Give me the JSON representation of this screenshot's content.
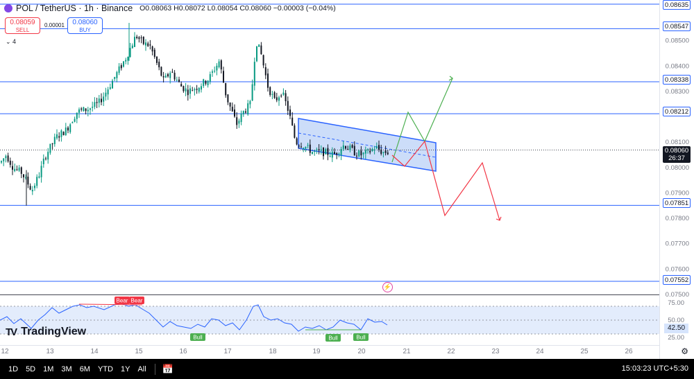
{
  "header": {
    "symbol": "POL / TetherUS · 1h · Binance",
    "ohlc": "O0.08063 H0.08072 L0.08054 C0.08060 −0.00003 (−0.04%)"
  },
  "trade": {
    "sell_price": "0.08059",
    "sell_label": "SELL",
    "buy_price": "0.08060",
    "buy_label": "BUY",
    "spread": "0.00001"
  },
  "indicators_toggle": "⌄ 4",
  "logo": {
    "mark": "TV",
    "text": "TradingView"
  },
  "price_axis": {
    "ticks": [
      "0.08500",
      "0.08400",
      "0.08300",
      "0.08100",
      "0.08000",
      "0.07900",
      "0.07800",
      "0.07700",
      "0.07600",
      "0.07500"
    ],
    "levels": [
      "0.08635",
      "0.08547",
      "0.08338",
      "0.08212",
      "0.07851",
      "0.07552"
    ],
    "current_price": "0.08060",
    "countdown": "26:37"
  },
  "rsi": {
    "ticks": [
      "75.00",
      "50.00",
      "25.00"
    ],
    "current": "42.50",
    "labels": [
      "Bear",
      "Bear",
      "Bull",
      "Bull",
      "Bull"
    ]
  },
  "time_axis": [
    "12",
    "13",
    "14",
    "15",
    "16",
    "17",
    "18",
    "19",
    "20",
    "21",
    "22",
    "23",
    "24",
    "25",
    "26"
  ],
  "bottom_bar": {
    "timeframes": [
      "1D",
      "5D",
      "1M",
      "3M",
      "6M",
      "YTD",
      "1Y",
      "All"
    ],
    "clock": "15:03:23 UTC+5:30"
  },
  "colors": {
    "up": "#089981",
    "down": "#131722",
    "level_line": "#2962ff",
    "channel_fill": "#bbd2f7",
    "bull_path": "#4caf50",
    "bear_path": "#f23645",
    "rsi_line": "#2962ff",
    "rsi_band": "#e3ecfc"
  },
  "chart_data": {
    "type": "candlestick",
    "timeframe": "1h",
    "price_range": [
      0.075,
      0.0866
    ],
    "horizontal_levels": [
      0.08635,
      0.08547,
      0.08338,
      0.08212,
      0.07851,
      0.07552
    ],
    "close_path": [
      [
        0,
        0.0802
      ],
      [
        8,
        0.0805
      ],
      [
        18,
        0.08
      ],
      [
        30,
        0.0798
      ],
      [
        45,
        0.0791
      ],
      [
        55,
        0.0797
      ],
      [
        65,
        0.0805
      ],
      [
        80,
        0.0812
      ],
      [
        95,
        0.0815
      ],
      [
        110,
        0.0822
      ],
      [
        125,
        0.0823
      ],
      [
        140,
        0.0825
      ],
      [
        150,
        0.0829
      ],
      [
        165,
        0.0836
      ],
      [
        180,
        0.0843
      ],
      [
        195,
        0.0852
      ],
      [
        205,
        0.0849
      ],
      [
        215,
        0.0848
      ],
      [
        225,
        0.0841
      ],
      [
        235,
        0.0834
      ],
      [
        245,
        0.0838
      ],
      [
        260,
        0.0832
      ],
      [
        270,
        0.083
      ],
      [
        285,
        0.0832
      ],
      [
        300,
        0.0835
      ],
      [
        315,
        0.0842
      ],
      [
        325,
        0.0828
      ],
      [
        340,
        0.0817
      ],
      [
        350,
        0.0822
      ],
      [
        360,
        0.0825
      ],
      [
        368,
        0.085
      ],
      [
        375,
        0.0845
      ],
      [
        385,
        0.0832
      ],
      [
        395,
        0.0826
      ],
      [
        405,
        0.083
      ],
      [
        415,
        0.0822
      ],
      [
        425,
        0.081
      ],
      [
        435,
        0.0809
      ],
      [
        450,
        0.0806
      ],
      [
        465,
        0.0806
      ],
      [
        480,
        0.0805
      ],
      [
        495,
        0.0809
      ],
      [
        510,
        0.0806
      ],
      [
        520,
        0.0805
      ],
      [
        530,
        0.0806
      ],
      [
        540,
        0.0808
      ],
      [
        550,
        0.0806
      ],
      [
        558,
        0.0806
      ]
    ],
    "x_labels": [
      "12",
      "13",
      "14",
      "15",
      "16",
      "17",
      "18",
      "19",
      "20",
      "21",
      "22",
      "23",
      "24",
      "25",
      "26"
    ],
    "rsi_range": [
      25,
      75
    ]
  }
}
